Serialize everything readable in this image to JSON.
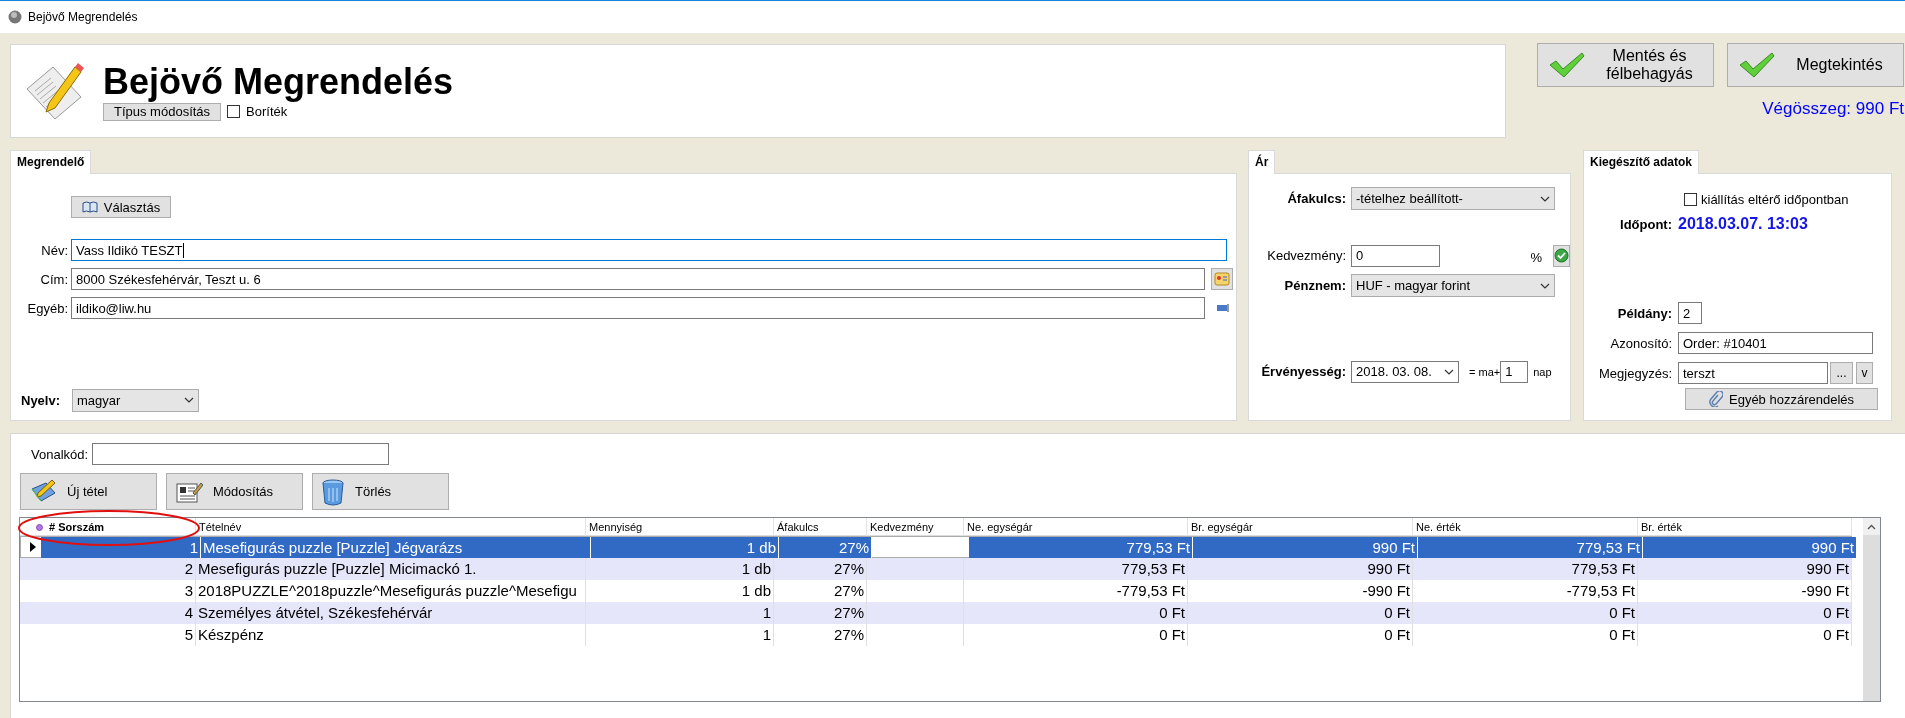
{
  "window": {
    "title": "Bejövő Megrendelés"
  },
  "header": {
    "title": "Bejövő Megrendelés",
    "type_button": "Típus módosítás",
    "envelope": {
      "label": "Boríték",
      "checked": false
    }
  },
  "actions": [
    {
      "label": "Mentés és félbehagyás"
    },
    {
      "label": "Megtekintés"
    }
  ],
  "total": "Végösszeg: 990 Ft",
  "customer": {
    "tab": "Megrendelő",
    "choose_button": "Választás",
    "fields": [
      {
        "label": "Név:",
        "value": "Vass Ildikó TESZT",
        "focused": true,
        "kind": "plain"
      },
      {
        "label": "Cím:",
        "value": "8000 Székesfehérvár, Teszt u. 6",
        "focused": false,
        "kind": "address"
      },
      {
        "label": "Egyéb:",
        "value": "ildiko@liw.hu",
        "focused": false,
        "kind": "other"
      }
    ],
    "language": {
      "label": "Nyelv:",
      "value": "magyar"
    }
  },
  "price": {
    "tab": "Ár",
    "vat": {
      "label": "Áfakulcs:",
      "value": "-tételhez beállított-"
    },
    "discount": {
      "label": "Kedvezmény:",
      "value": "0",
      "unit": "%"
    },
    "currency": {
      "label": "Pénznem:",
      "value": "HUF - magyar forint"
    },
    "validity": {
      "label": "Érvényesség:",
      "value": "2018. 03. 08.",
      "prefix": "= ma+",
      "days": "1",
      "unit": "nap"
    }
  },
  "extra": {
    "tab": "Kiegészítő adatok",
    "different_time": {
      "label": "kiállítás eltérő időpontban",
      "checked": false
    },
    "time": {
      "label": "Időpont:",
      "value": "2018.03.07. 13:03"
    },
    "copies": {
      "label": "Példány:",
      "value": "2"
    },
    "identifier": {
      "label": "Azonosító:",
      "value": "Order: #10401"
    },
    "note": {
      "label": "Megjegyzés:",
      "value": "terszt",
      "more_button": "...",
      "dropdown_button": "v"
    },
    "attach_button": "Egyéb hozzárendelés"
  },
  "items": {
    "barcode": {
      "label": "Vonalkód:"
    },
    "buttons": [
      {
        "label": "Új tétel",
        "kind": "new"
      },
      {
        "label": "Módosítás",
        "kind": "edit"
      },
      {
        "label": "Törlés",
        "kind": "delete"
      }
    ],
    "table": {
      "columns": [
        "# Sorszám",
        "Tételnév",
        "Mennyiség",
        "Áfakulcs",
        "Kedvezmény",
        "Ne. egységár",
        "Br. egységár",
        "Ne. érték",
        "Br. érték"
      ],
      "rows": [
        {
          "selected": true,
          "cells": [
            "1",
            "Mesefigurás puzzle [Puzzle] Jégvarázs",
            "1 db",
            "27%",
            "",
            "779,53 Ft",
            "990 Ft",
            "779,53 Ft",
            "990 Ft"
          ]
        },
        {
          "selected": false,
          "cells": [
            "2",
            "Mesefigurás puzzle [Puzzle] Micimackó 1.",
            "1 db",
            "27%",
            "",
            "779,53 Ft",
            "990 Ft",
            "779,53 Ft",
            "990 Ft"
          ]
        },
        {
          "selected": false,
          "cells": [
            "3",
            "2018PUZZLE^2018puzzle^Mesefigurás puzzle^Mesefigu",
            "1 db",
            "27%",
            "",
            "-779,53 Ft",
            "-990 Ft",
            "-779,53 Ft",
            "-990 Ft"
          ]
        },
        {
          "selected": false,
          "cells": [
            "4",
            "Személyes átvétel, Székesfehérvár",
            "1",
            "27%",
            "",
            "0 Ft",
            "0 Ft",
            "0 Ft",
            "0 Ft"
          ]
        },
        {
          "selected": false,
          "cells": [
            "5",
            "Készpénz",
            "1",
            "27%",
            "",
            "0 Ft",
            "0 Ft",
            "0 Ft",
            "0 Ft"
          ]
        }
      ]
    }
  }
}
